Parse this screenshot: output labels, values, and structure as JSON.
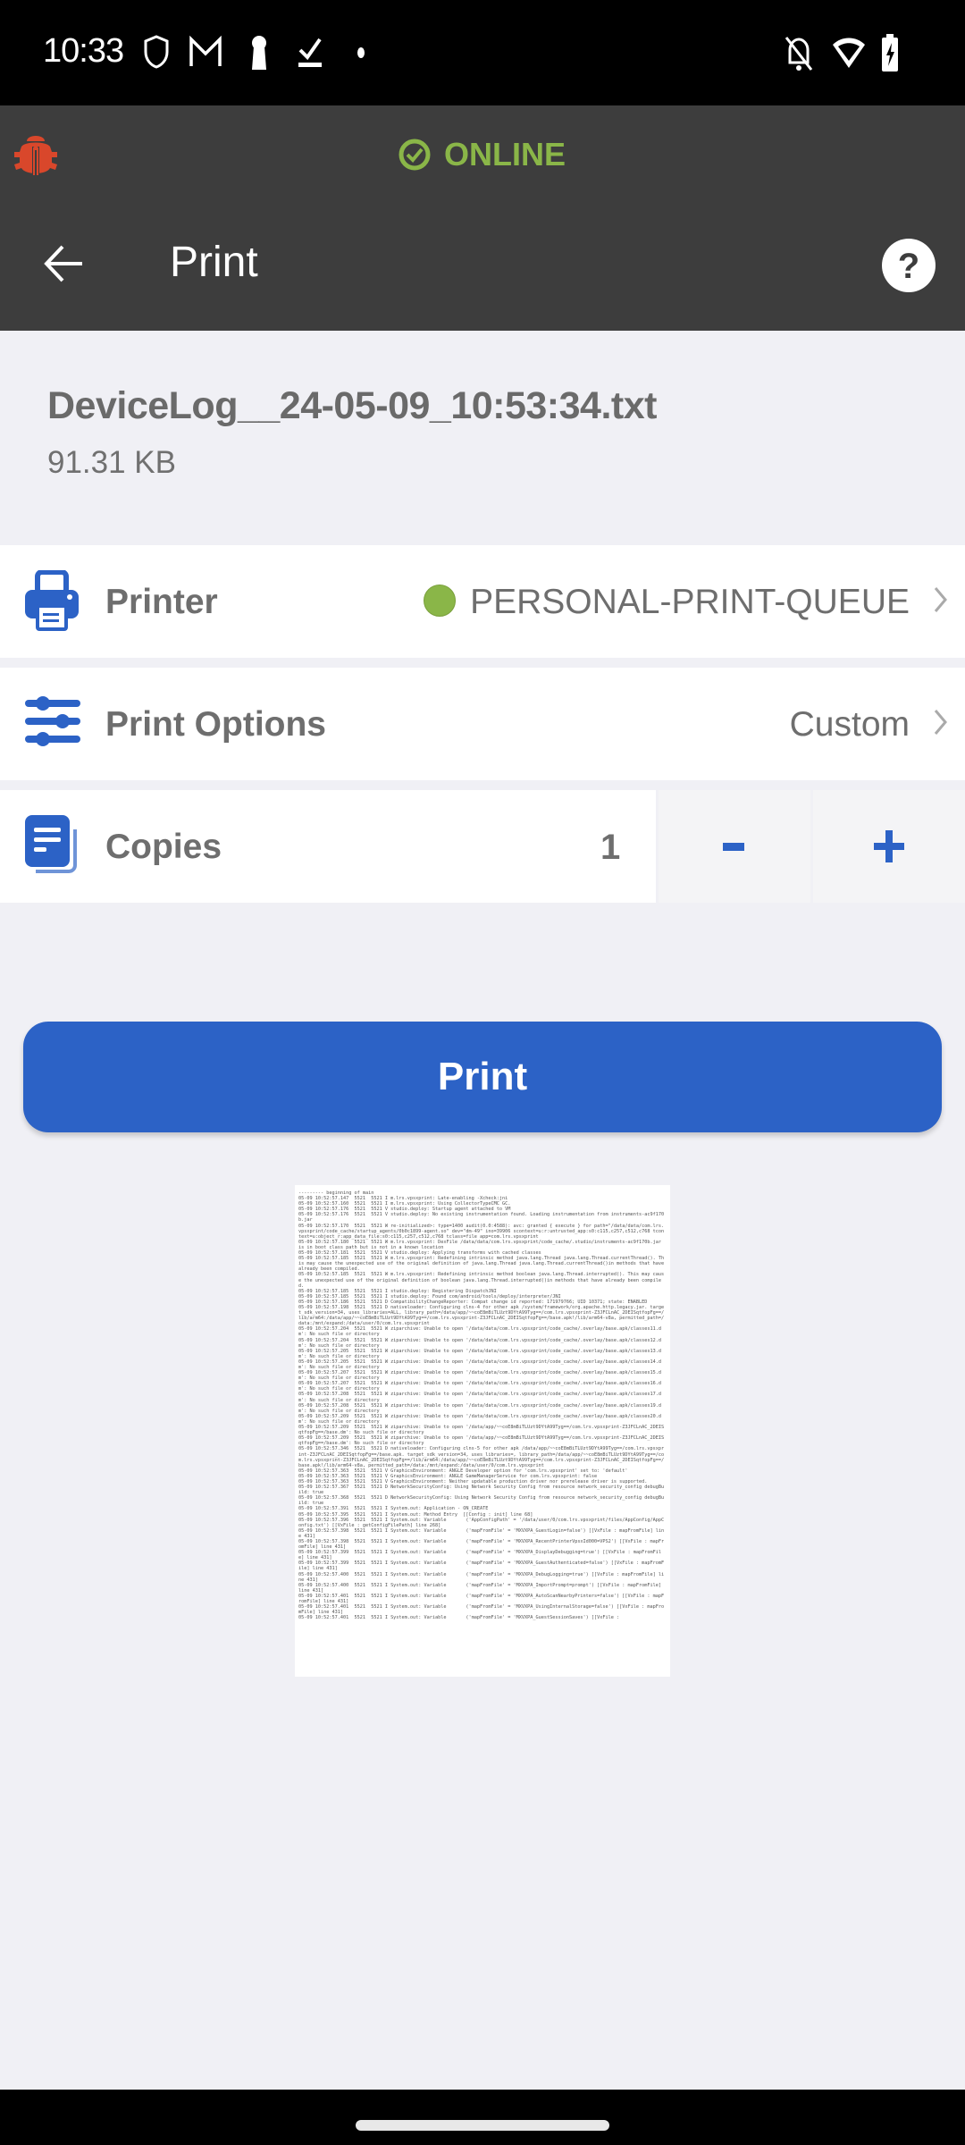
{
  "status_bar": {
    "time": "10:33",
    "left_icons": [
      "shield-icon",
      "gmail-icon",
      "keyhole-icon",
      "task-check-icon",
      "dot-icon"
    ],
    "right_icons": [
      "notifications-off-icon",
      "wifi-icon",
      "battery-charging-icon"
    ]
  },
  "header": {
    "connection_status": "ONLINE",
    "status_color": "#8ab648",
    "bug_icon_color": "#d9472b",
    "title": "Print"
  },
  "file": {
    "name": "DeviceLog__24-05-09_10:53:34.txt",
    "size": "91.31 KB"
  },
  "settings": {
    "printer": {
      "label": "Printer",
      "value": "PERSONAL-PRINT-QUEUE",
      "status_color": "#8ab648"
    },
    "print_options": {
      "label": "Print Options",
      "value": "Custom"
    },
    "copies": {
      "label": "Copies",
      "value": "1",
      "decrement_label": "-",
      "increment_label": "+"
    }
  },
  "print_button": {
    "label": "Print",
    "color": "#2c62c6"
  },
  "preview": {
    "text": "--------- beginning of main\n05-09 10:52:57.147  5521  5521 I m.lrs.vpsxprint: Late-enabling -Xcheck:jni\n05-09 10:52:57.160  5521  5521 I m.lrs.vpsxprint: Using CollectorTypeCMC GC.\n05-09 10:52:57.176  5521  5521 V studio.deploy: Startup agent attached to VM\n05-09 10:52:57.176  5521  5521 V studio.deploy: No existing instrumentation found. Loading instrumentation from instruments-ac9f170b.jar\n05-09 10:52:57.170  5521  5521 W re-initialized>: type=1400 audit(0.0:4588): avc: granted { execute } for path=\"/data/data/com.lrs.vpsxprint/code_cache/startup_agents/0b0c1899-agent.so\" dev=\"dm-49\" ino=39906 scontext=u:r:untrusted_app:s0:c115,c257,c512,c768 tcontext=u:object_r:app_data_file:s0:c115,c257,c512,c768 tclass=file app=com.lrs.vpsxprint\n05-09 10:52:57.180  5521  5521 W m.lrs.vpsxprint: DexFile /data/data/com.lrs.vpsxprint/code_cache/.studio/instruments-ac9f170b.jar is in boot class path but is not in a known location\n05-09 10:52:57.181  5521  5521 V studio.deploy: Applying transforms with cached classes\n05-09 10:52:57.185  5521  5521 W m.lrs.vpsxprint: Redefining intrinsic method java.lang.Thread java.lang.Thread.currentThread(). This may cause the unexpected use of the original definition of java.lang.Thread java.lang.Thread.currentThread()in methods that have already been compiled.\n05-09 10:52:57.185  5521  5521 W m.lrs.vpsxprint: Redefining intrinsic method boolean java.lang.Thread.interrupted(). This may cause the unexpected use of the original definition of boolean java.lang.Thread.interrupted()in methods that have already been compiled.\n05-09 10:52:57.185  5521  5521 I studio.deploy: Registering DispatchJNI\n05-09 10:52:57.185  5521  5521 I studio.deploy: Found com/android/tools/deploy/interpreter/JNI\n05-09 10:52:57.186  5521  5521 D CompatibilityChangeReporter: Compat change id reported: 171979766; UID 10371; state: ENABLED\n05-09 10:52:57.198  5521  5521 D nativeloader: Configuring clns-4 for other apk /system/framework/org.apache.http.legacy.jar. target_sdk_version=34, uses_libraries=ALL, library_path=/data/app/~~coE8mBiTLUzt9DYtA99Tyg==/com.lrs.vpsxprint-Z3JFCLnAC_2DEISqtfopFg==/lib/arm64:/data/app/~~coE8mBiTLUzt9DYtA99Tyg==/com.lrs.vpsxprint-Z3JFCLnAC_2DEISqtfopFg==/base.apk!/lib/arm64-v8a, permitted_path=/data:/mnt/expand:/data/user/0/com.lrs.vpsxprint\n05-09 10:52:57.204  5521  5521 W ziparchive: Unable to open '/data/data/com.lrs.vpsxprint/code_cache/.overlay/base.apk/classes11.dm': No such file or directory\n05-09 10:52:57.204  5521  5521 W ziparchive: Unable to open '/data/data/com.lrs.vpsxprint/code_cache/.overlay/base.apk/classes12.dm': No such file or directory\n05-09 10:52:57.205  5521  5521 W ziparchive: Unable to open '/data/data/com.lrs.vpsxprint/code_cache/.overlay/base.apk/classes13.dm': No such file or directory\n05-09 10:52:57.205  5521  5521 W ziparchive: Unable to open '/data/data/com.lrs.vpsxprint/code_cache/.overlay/base.apk/classes14.dm': No such file or directory\n05-09 10:52:57.207  5521  5521 W ziparchive: Unable to open '/data/data/com.lrs.vpsxprint/code_cache/.overlay/base.apk/classes15.dm': No such file or directory\n05-09 10:52:57.207  5521  5521 W ziparchive: Unable to open '/data/data/com.lrs.vpsxprint/code_cache/.overlay/base.apk/classes16.dm': No such file or directory\n05-09 10:52:57.208  5521  5521 W ziparchive: Unable to open '/data/data/com.lrs.vpsxprint/code_cache/.overlay/base.apk/classes17.dm': No such file or directory\n05-09 10:52:57.208  5521  5521 W ziparchive: Unable to open '/data/data/com.lrs.vpsxprint/code_cache/.overlay/base.apk/classes19.dm': No such file or directory\n05-09 10:52:57.209  5521  5521 W ziparchive: Unable to open '/data/data/com.lrs.vpsxprint/code_cache/.overlay/base.apk/classes20.dm': No such file or directory\n05-09 10:52:57.209  5521  5521 W ziparchive: Unable to open '/data/app/~~coE8mBiTLUzt9DYtA99Tyg==/com.lrs.vpsxprint-Z3JFCLnAC_2DEISqtfopFg==/base.dm': No such file or directory\n05-09 10:52:57.209  5521  5521 W ziparchive: Unable to open '/data/app/~~coE8mBiTLUzt9DYtA99Tyg==/com.lrs.vpsxprint-Z3JFCLnAC_2DEISqtfopFg==/base.dm': No such file or directory\n05-09 10:52:57.346  5521  5521 D nativeloader: Configuring clns-5 for other apk /data/app/~~coE8mBiTLUzt9DYtA99Tyg==/com.lrs.vpsxprint-Z3JFCLnAC_2DEISqtfopFg==/base.apk. target_sdk_version=34, uses_libraries=, library_path=/data/app/~~coE8mBiTLUzt9DYtA99Tyg==/com.lrs.vpsxprint-Z3JFCLnAC_2DEISqtfopFg==/lib/arm64:/data/app/~~coE8mBiTLUzt9DYtA99Tyg==/com.lrs.vpsxprint-Z3JFCLnAC_2DEISqtfopFg==/base.apk!/lib/arm64-v8a, permitted_path=/data:/mnt/expand:/data/user/0/com.lrs.vpsxprint\n05-09 10:52:57.363  5521  5521 V GraphicsEnvironment: ANGLE Developer option for 'com.lrs.vpsxprint' set to: 'default'\n05-09 10:52:57.363  5521  5521 V GraphicsEnvironment: ANGLE GameManagerService for com.lrs.vpsxprint: false\n05-09 10:52:57.363  5521  5521 V GraphicsEnvironment: Neither updatable production driver nor prerelease driver is supported.\n05-09 10:52:57.367  5521  5521 D NetworkSecurityConfig: Using Network Security Config from resource network_security_config debugBuild: true\n05-09 10:52:57.368  5521  5521 D NetworkSecurityConfig: Using Network Security Config from resource network_security_config debugBuild: true\n05-09 10:52:57.391  5521  5521 I System.out: Application - ON_CREATE\n05-09 10:52:57.395  5521  5521 I System.out: Method Entry  [[Config : init] line 68]\n05-09 10:52:57.396  5521  5521 I System.out: Variable       ('AppConfigPath' = '/data/user/0/com.lrs.vpsxprint/files/AppConfig/AppConfig.txt') [[VxFile : getConfigFilePath] line 268]\n05-09 10:52:57.398  5521  5521 I System.out: Variable       ('mapFromFile' = 'MXVXPA_GuestLogin=false') [[VxFile : mapFromFile] line 431]\n05-09 10:52:57.398  5521  5521 I System.out: Variable       ('mapFromFile' = 'MXVXPA_RecentPrinterVpsxId000=VPS2') [[VxFile : mapFromFile] line 431]\n05-09 10:52:57.399  5521  5521 I System.out: Variable       ('mapFromFile' = 'MXVXPA_DisplayDebugging=true') [[VxFile : mapFromFile] line 431]\n05-09 10:52:57.399  5521  5521 I System.out: Variable       ('mapFromFile' = 'MXVXPA_GuestAuthenticated=false') [[VxFile : mapFromFile] line 431]\n05-09 10:52:57.400  5521  5521 I System.out: Variable       ('mapFromFile' = 'MXVXPA_DebugLogging=true') [[VxFile : mapFromFile] line 431]\n05-09 10:52:57.400  5521  5521 I System.out: Variable       ('mapFromFile' = 'MXVXPA_ImportPrompt=prompt') [[VxFile : mapFromFile] line 431]\n05-09 10:52:57.401  5521  5521 I System.out: Variable       ('mapFromFile' = 'MXVXPA_AutoScanNearbyPrinters=false') [[VxFile : mapFromFile] line 431]\n05-09 10:52:57.401  5521  5521 I System.out: Variable       ('mapFromFile' = 'MXVXPA_UsingInternalStorage=false') [[VxFile : mapFromFile] line 431]\n05-09 10:52:57.401  5521  5521 I System.out: Variable       ('mapFromFile' = 'MXVXPA_GuestSessionSaves') [[VxFile :"
  }
}
